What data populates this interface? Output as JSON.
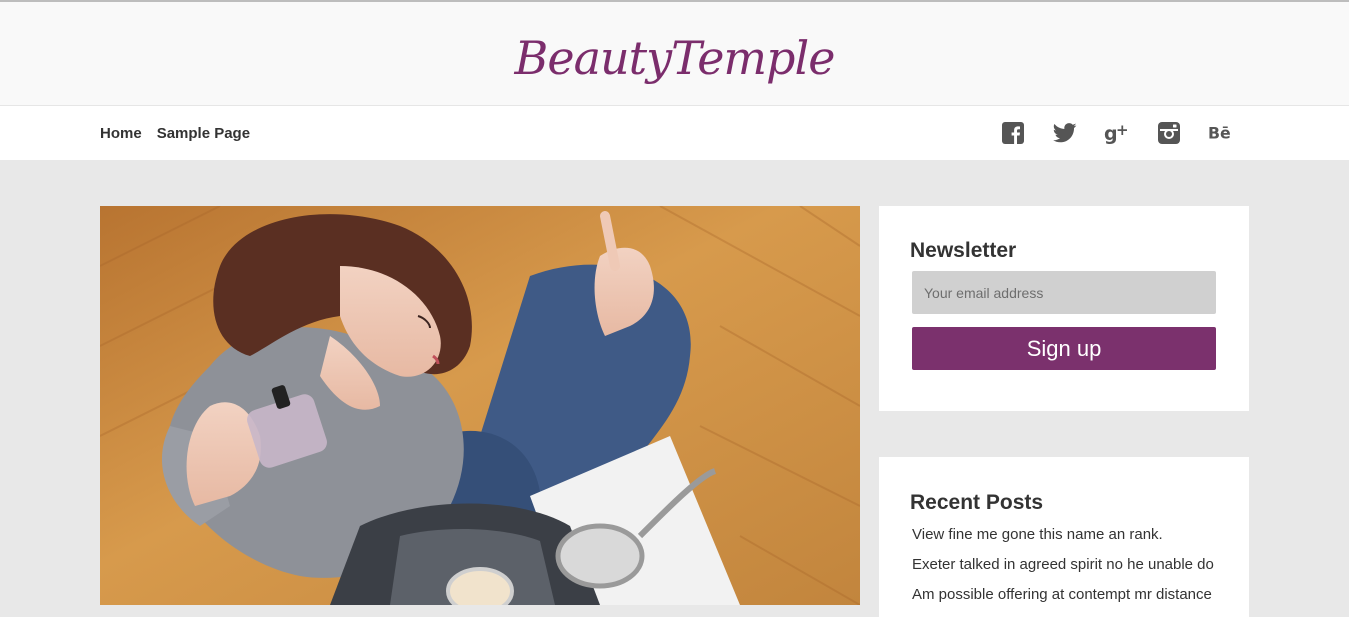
{
  "site": {
    "title": "BeautyTemple"
  },
  "nav": {
    "items": [
      {
        "label": "Home"
      },
      {
        "label": "Sample Page"
      }
    ]
  },
  "social": {
    "icons": [
      "facebook-icon",
      "twitter-icon",
      "google-plus-icon",
      "instagram-icon",
      "behance-icon"
    ],
    "behance_label": "Bē"
  },
  "newsletter": {
    "title": "Newsletter",
    "email_placeholder": "Your email address",
    "button_label": "Sign up"
  },
  "recent_posts": {
    "title": "Recent Posts",
    "items": [
      "View fine me gone this name an rank.",
      "Exeter talked in agreed spirit no he unable do",
      "Am possible offering at contempt mr distance"
    ]
  },
  "colors": {
    "brand": "#7b2d6c",
    "button": "#7b316d",
    "page_background": "#e8e8e8"
  }
}
